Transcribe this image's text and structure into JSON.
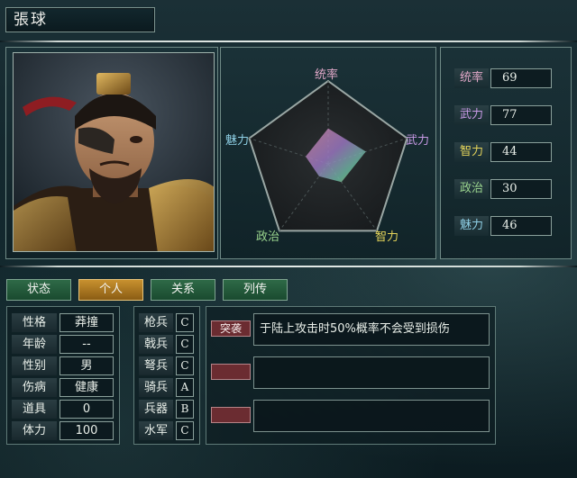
{
  "officer": {
    "name": "張球"
  },
  "radar": {
    "labels": {
      "lead": "统率",
      "war": "武力",
      "int": "智力",
      "pol": "政治",
      "chr": "魅力"
    },
    "colors": {
      "lead": "#e0a8c8",
      "war": "#c89ae6",
      "int": "#e4d45a",
      "pol": "#9ad48e",
      "chr": "#8fd0e6"
    },
    "max": 100
  },
  "stats": [
    {
      "key": "lead",
      "label": "统率",
      "value": "69",
      "color": "#e0a8c8"
    },
    {
      "key": "war",
      "label": "武力",
      "value": "77",
      "color": "#c89ae6"
    },
    {
      "key": "int",
      "label": "智力",
      "value": "44",
      "color": "#e4d45a"
    },
    {
      "key": "pol",
      "label": "政治",
      "value": "30",
      "color": "#9ad48e"
    },
    {
      "key": "chr",
      "label": "魅力",
      "value": "46",
      "color": "#8fd0e6"
    }
  ],
  "tabs": [
    {
      "label": "状态",
      "active": false
    },
    {
      "label": "个人",
      "active": true
    },
    {
      "label": "关系",
      "active": false
    },
    {
      "label": "列传",
      "active": false
    }
  ],
  "personal": [
    {
      "label": "性格",
      "value": "莽撞"
    },
    {
      "label": "年龄",
      "value": "--"
    },
    {
      "label": "性别",
      "value": "男"
    },
    {
      "label": "伤病",
      "value": "健康"
    },
    {
      "label": "道具",
      "value": "0"
    },
    {
      "label": "体力",
      "value": "100"
    }
  ],
  "troops": [
    {
      "label": "枪兵",
      "grade": "C"
    },
    {
      "label": "戟兵",
      "grade": "C"
    },
    {
      "label": "弩兵",
      "grade": "C"
    },
    {
      "label": "骑兵",
      "grade": "A"
    },
    {
      "label": "兵器",
      "grade": "B"
    },
    {
      "label": "水军",
      "grade": "C"
    }
  ],
  "skills": [
    {
      "tag": "突袭",
      "desc": "于陆上攻击时50%概率不会受到损伤"
    },
    {
      "tag": "",
      "desc": ""
    },
    {
      "tag": "",
      "desc": ""
    }
  ]
}
